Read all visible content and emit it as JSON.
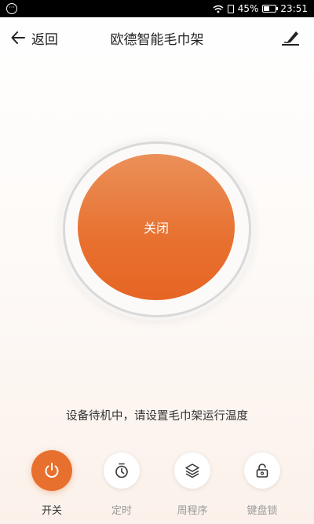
{
  "status_bar": {
    "battery": "45%",
    "time": "23:51"
  },
  "header": {
    "back_label": "返回",
    "title": "欧德智能毛巾架"
  },
  "power": {
    "label": "关闭"
  },
  "status_message": "设备待机中，请设置毛巾架运行温度",
  "bottom_nav": [
    {
      "label": "开关",
      "icon": "power-icon"
    },
    {
      "label": "定时",
      "icon": "timer-icon"
    },
    {
      "label": "周程序",
      "icon": "layers-icon"
    },
    {
      "label": "键盘锁",
      "icon": "lock-icon"
    }
  ],
  "colors": {
    "accent": "#e8702f",
    "text": "#333333",
    "muted": "#999999"
  }
}
